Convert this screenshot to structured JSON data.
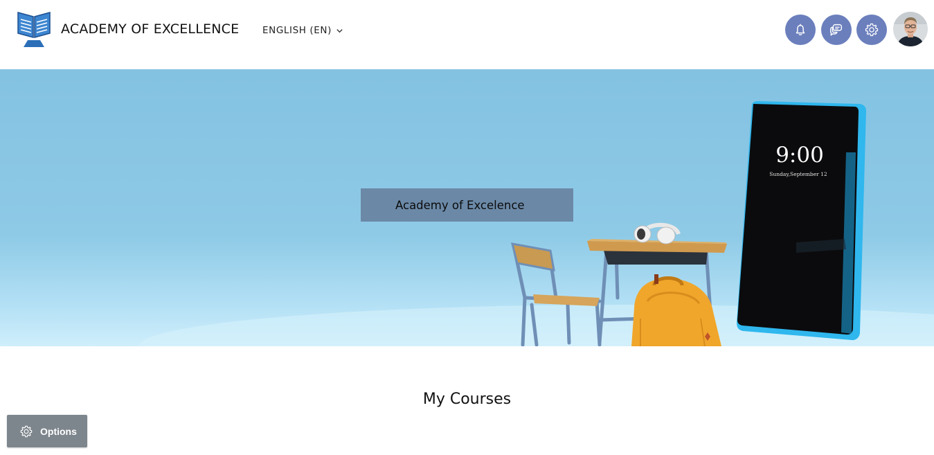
{
  "header": {
    "site_name": "ACADEMY OF EXCELLENCE",
    "language_label": "ENGLISH (EN)",
    "icons": [
      "logo-icon",
      "bell-icon",
      "chat-icon",
      "gear-icon",
      "avatar"
    ]
  },
  "hero": {
    "title": "Academy of Excelence",
    "phone_time": "9:00",
    "phone_date": "Sunday,September 12"
  },
  "main": {
    "section_title": "My Courses"
  },
  "options": {
    "label": "Options"
  },
  "colors": {
    "accent": "#6b7fbd",
    "hero_sky": "#8ecae6",
    "options_bg": "#7e868d"
  }
}
